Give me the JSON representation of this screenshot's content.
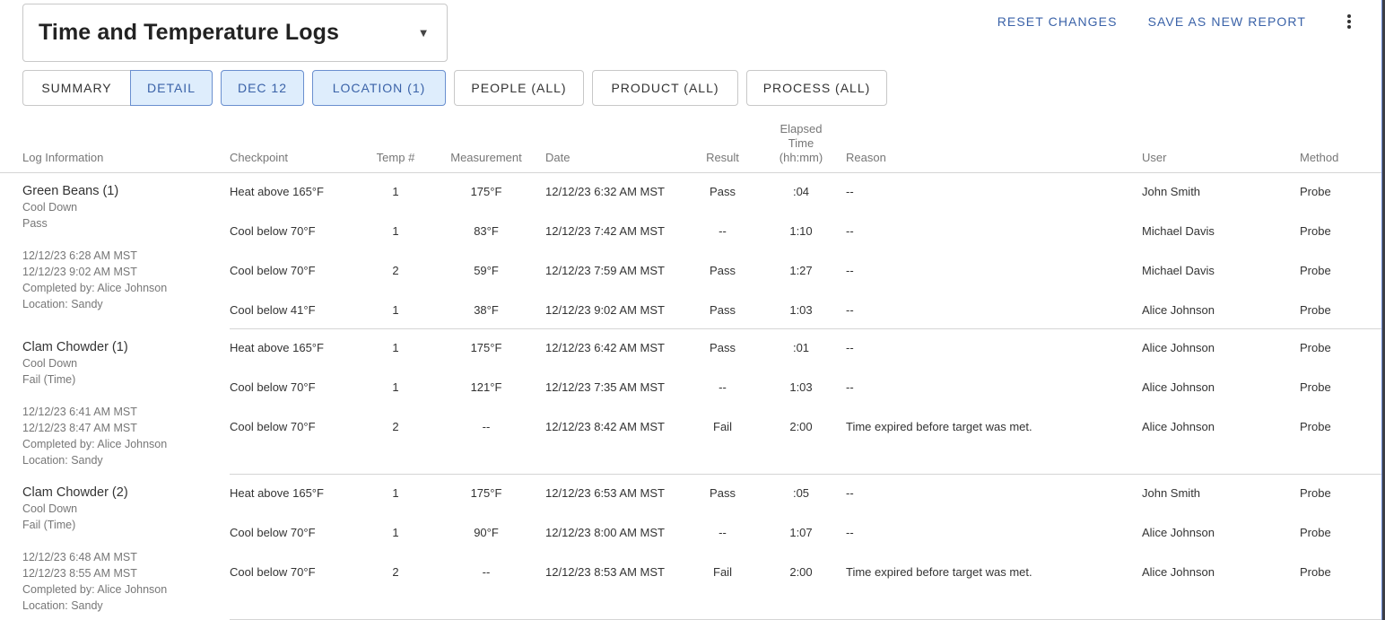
{
  "header": {
    "report_title": "Time and Temperature Logs",
    "dropdown_icon": "caret-down-icon",
    "actions": {
      "reset": "RESET CHANGES",
      "save_new": "SAVE AS NEW REPORT",
      "more_icon": "kebab-menu-icon"
    }
  },
  "filters": {
    "view_toggle": {
      "summary": "SUMMARY",
      "detail": "DETAIL",
      "selected": "DETAIL"
    },
    "date": "DEC 12",
    "location": "LOCATION (1)",
    "people": "PEOPLE (ALL)",
    "product": "PRODUCT (ALL)",
    "process": "PROCESS (ALL)"
  },
  "table": {
    "columns": {
      "log_info": "Log Information",
      "checkpoint": "Checkpoint",
      "temp_no": "Temp #",
      "measurement": "Measurement",
      "date": "Date",
      "result": "Result",
      "elapsed_1": "Elapsed",
      "elapsed_2": "Time",
      "elapsed_3": "(hh:mm)",
      "reason": "Reason",
      "user": "User",
      "method": "Method"
    },
    "logs": [
      {
        "name": "Green Beans (1)",
        "process": "Cool Down",
        "status": "Pass",
        "start": "12/12/23 6:28 AM MST",
        "end": "12/12/23 9:02 AM MST",
        "completed_by": "Completed by: Alice Johnson",
        "location": "Location: Sandy",
        "rows": [
          {
            "checkpoint": "Heat above 165°F",
            "temp_no": "1",
            "measurement": "175°F",
            "date": "12/12/23 6:32 AM MST",
            "result": "Pass",
            "elapsed": ":04",
            "reason": "--",
            "user": "John Smith",
            "method": "Probe"
          },
          {
            "checkpoint": "Cool below 70°F",
            "temp_no": "1",
            "measurement": "83°F",
            "date": "12/12/23 7:42 AM MST",
            "result": "--",
            "elapsed": "1:10",
            "reason": "--",
            "user": "Michael Davis",
            "method": "Probe"
          },
          {
            "checkpoint": "Cool below 70°F",
            "temp_no": "2",
            "measurement": "59°F",
            "date": "12/12/23 7:59 AM MST",
            "result": "Pass",
            "elapsed": "1:27",
            "reason": "--",
            "user": "Michael Davis",
            "method": "Probe"
          },
          {
            "checkpoint": "Cool below 41°F",
            "temp_no": "1",
            "measurement": "38°F",
            "date": "12/12/23 9:02 AM MST",
            "result": "Pass",
            "elapsed": "1:03",
            "reason": "--",
            "user": "Alice Johnson",
            "method": "Probe"
          }
        ]
      },
      {
        "name": "Clam Chowder (1)",
        "process": "Cool Down",
        "status": "Fail (Time)",
        "start": "12/12/23 6:41 AM MST",
        "end": "12/12/23 8:47 AM MST",
        "completed_by": "Completed by: Alice Johnson",
        "location": "Location: Sandy",
        "rows": [
          {
            "checkpoint": "Heat above 165°F",
            "temp_no": "1",
            "measurement": "175°F",
            "date": "12/12/23 6:42 AM MST",
            "result": "Pass",
            "elapsed": ":01",
            "reason": "--",
            "user": "Alice Johnson",
            "method": "Probe"
          },
          {
            "checkpoint": "Cool below 70°F",
            "temp_no": "1",
            "measurement": "121°F",
            "date": "12/12/23 7:35 AM MST",
            "result": "--",
            "elapsed": "1:03",
            "reason": "--",
            "user": "Alice Johnson",
            "method": "Probe"
          },
          {
            "checkpoint": "Cool below 70°F",
            "temp_no": "2",
            "measurement": "--",
            "date": "12/12/23 8:42 AM MST",
            "result": "Fail",
            "elapsed": "2:00",
            "reason": "Time expired before target was met.",
            "user": "Alice Johnson",
            "method": "Probe"
          }
        ]
      },
      {
        "name": "Clam Chowder (2)",
        "process": "Cool Down",
        "status": "Fail (Time)",
        "start": "12/12/23 6:48 AM MST",
        "end": "12/12/23 8:55 AM MST",
        "completed_by": "Completed by: Alice Johnson",
        "location": "Location: Sandy",
        "rows": [
          {
            "checkpoint": "Heat above 165°F",
            "temp_no": "1",
            "measurement": "175°F",
            "date": "12/12/23 6:53 AM MST",
            "result": "Pass",
            "elapsed": ":05",
            "reason": "--",
            "user": "John Smith",
            "method": "Probe"
          },
          {
            "checkpoint": "Cool below 70°F",
            "temp_no": "1",
            "measurement": "90°F",
            "date": "12/12/23 8:00 AM MST",
            "result": "--",
            "elapsed": "1:07",
            "reason": "--",
            "user": "Alice Johnson",
            "method": "Probe"
          },
          {
            "checkpoint": "Cool below 70°F",
            "temp_no": "2",
            "measurement": "--",
            "date": "12/12/23 8:53 AM MST",
            "result": "Fail",
            "elapsed": "2:00",
            "reason": "Time expired before target was met.",
            "user": "Alice Johnson",
            "method": "Probe"
          }
        ]
      }
    ]
  },
  "colors": {
    "accent": "#3a62a8",
    "active_bg": "#deedfc",
    "active_border": "#6a8fcf",
    "border": "#c8c8c8",
    "muted_text": "#777777"
  }
}
